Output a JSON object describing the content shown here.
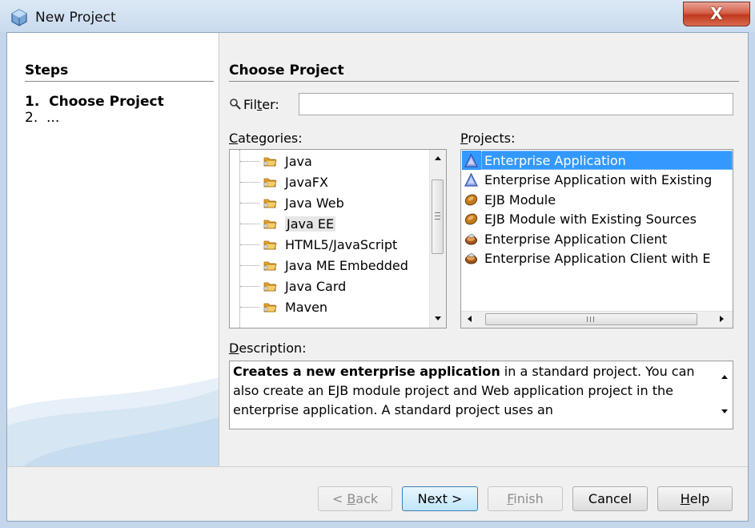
{
  "window": {
    "title": "New Project",
    "close_glyph": "X"
  },
  "steps": {
    "title": "Steps",
    "items": [
      "1.  Choose Project",
      "2.  ..."
    ]
  },
  "main": {
    "title": "Choose Project",
    "filter": {
      "label_pre": "Fil",
      "label_ul": "t",
      "label_post": "er:",
      "value": ""
    },
    "categories": {
      "label_ul": "C",
      "label_rest": "ategories:",
      "items": [
        "Java",
        "JavaFX",
        "Java Web",
        "Java EE",
        "HTML5/JavaScript",
        "Java ME Embedded",
        "Java Card",
        "Maven"
      ],
      "selected": "Java EE"
    },
    "projects": {
      "label_ul": "P",
      "label_rest": "rojects:",
      "items": [
        {
          "label": "Enterprise Application",
          "icon": "enterprise-app-icon"
        },
        {
          "label": "Enterprise Application with Existing",
          "icon": "enterprise-app-icon"
        },
        {
          "label": "EJB Module",
          "icon": "ejb-module-icon"
        },
        {
          "label": "EJB Module with Existing Sources",
          "icon": "ejb-module-icon"
        },
        {
          "label": "Enterprise Application Client",
          "icon": "app-client-icon"
        },
        {
          "label": "Enterprise Application Client with E",
          "icon": "app-client-icon"
        }
      ],
      "selected": "Enterprise Application"
    },
    "description": {
      "label_ul": "D",
      "label_rest": "escription:",
      "bold": "Creates a new enterprise application",
      "text": " in a standard project. You can also create an EJB module project and Web application project in the enterprise application. A standard project uses an"
    }
  },
  "buttons": {
    "back": {
      "pre": "< ",
      "ul": "B",
      "post": "ack"
    },
    "next": "Next >",
    "finish": {
      "ul": "F",
      "post": "inish"
    },
    "cancel": "Cancel",
    "help": {
      "ul": "H",
      "post": "elp"
    }
  },
  "colors": {
    "selection": "#3399ff",
    "folder": "#f0b43a",
    "close": "#c9462c"
  }
}
